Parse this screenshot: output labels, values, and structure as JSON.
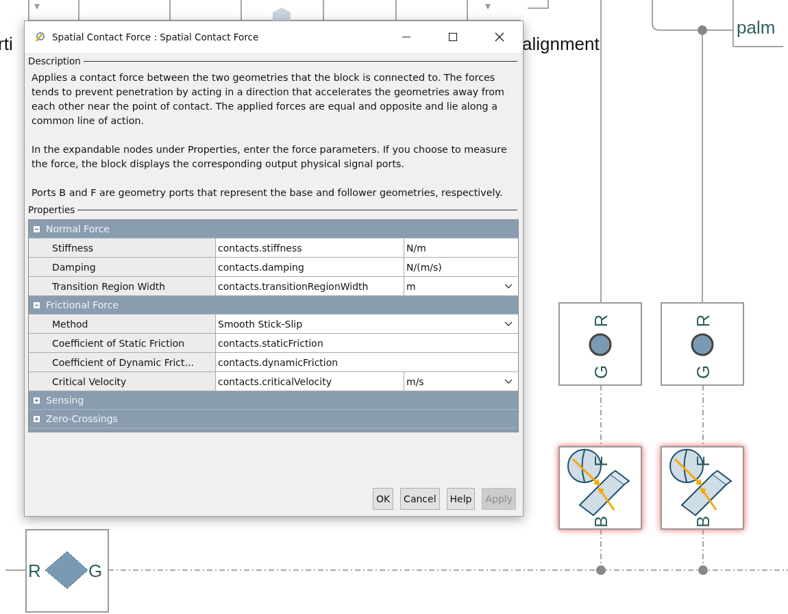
{
  "canvas": {
    "background_labels": [
      {
        "text": "rti"
      },
      {
        "text": "alignment"
      },
      {
        "text": "palm"
      }
    ],
    "joint_blocks": [
      {
        "port_top": "R",
        "port_bottom": "G"
      },
      {
        "port_top": "R",
        "port_bottom": "G"
      }
    ],
    "contact_blocks": [
      {
        "port_top": "F",
        "port_bottom": "B",
        "highlighted": true
      },
      {
        "port_top": "F",
        "port_bottom": "B",
        "highlighted": true
      }
    ],
    "transform_block": {
      "port_left": "R",
      "port_right": "G"
    }
  },
  "dialog": {
    "title": "Spatial Contact Force : Spatial Contact Force",
    "description_heading": "Description",
    "paragraphs": [
      "Applies a contact force between the two geometries that the block is connected to. The forces tends to prevent penetration by acting in a direction that accelerates the geometries away from each other near the point of contact.  The applied forces are equal and opposite and lie along a common line of action.",
      "In the expandable nodes under Properties, enter the force parameters. If you choose to measure the force, the block displays the corresponding output physical signal ports.",
      "Ports B and F are geometry ports that represent the base and follower geometries, respectively."
    ],
    "properties_heading": "Properties",
    "groups": [
      {
        "label": "Normal Force",
        "expanded": true,
        "rows": [
          {
            "name": "Stiffness",
            "value": "contacts.stiffness",
            "unit": "N/m",
            "dropdown": false
          },
          {
            "name": "Damping",
            "value": "contacts.damping",
            "unit": "N/(m/s)",
            "dropdown": false
          },
          {
            "name": "Transition Region Width",
            "value": "contacts.transitionRegionWidth",
            "unit": "m",
            "dropdown": true
          }
        ]
      },
      {
        "label": "Frictional Force",
        "expanded": true,
        "rows": [
          {
            "name": "Method",
            "value": "Smooth Stick-Slip",
            "dropdown": true
          },
          {
            "name": "Coefficient of Static Friction",
            "value": "contacts.staticFriction",
            "dropdown": false
          },
          {
            "name": "Coefficient of Dynamic Frict...",
            "value": "contacts.dynamicFriction",
            "dropdown": false
          },
          {
            "name": "Critical Velocity",
            "value": "contacts.criticalVelocity",
            "unit": "m/s",
            "dropdown": true
          }
        ]
      },
      {
        "label": "Sensing",
        "expanded": false
      },
      {
        "label": "Zero-Crossings",
        "expanded": false
      }
    ],
    "buttons": [
      {
        "label": "OK",
        "disabled": false
      },
      {
        "label": "Cancel",
        "disabled": false
      },
      {
        "label": "Help",
        "disabled": false
      },
      {
        "label": "Apply",
        "disabled": true
      }
    ]
  }
}
